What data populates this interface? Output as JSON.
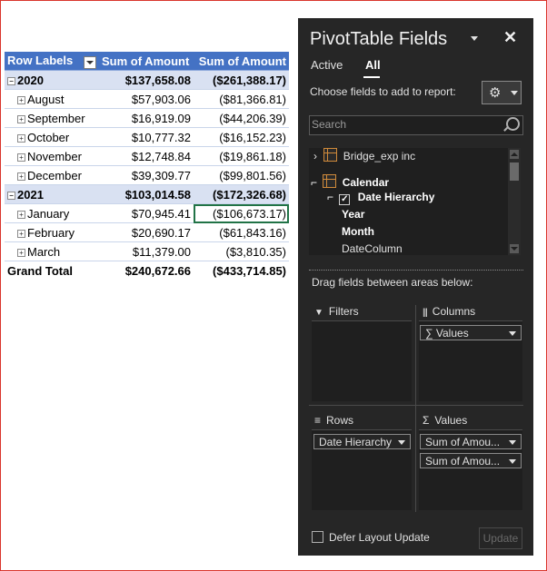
{
  "pivot": {
    "headers": [
      "Row Labels",
      "Sum of Amount",
      "Sum of Amount"
    ],
    "rows": [
      {
        "label": "2020",
        "a": "$137,658.08",
        "b": "($261,388.17)",
        "level": "year",
        "toggle": "⊟"
      },
      {
        "label": "August",
        "a": "$57,903.06",
        "b": "($81,366.81)",
        "level": "month",
        "toggle": "⊞"
      },
      {
        "label": "September",
        "a": "$16,919.09",
        "b": "($44,206.39)",
        "level": "month",
        "toggle": "⊞"
      },
      {
        "label": "October",
        "a": "$10,777.32",
        "b": "($16,152.23)",
        "level": "month",
        "toggle": "⊞"
      },
      {
        "label": "November",
        "a": "$12,748.84",
        "b": "($19,861.18)",
        "level": "month",
        "toggle": "⊞"
      },
      {
        "label": "December",
        "a": "$39,309.77",
        "b": "($99,801.56)",
        "level": "month",
        "toggle": "⊞"
      },
      {
        "label": "2021",
        "a": "$103,014.58",
        "b": "($172,326.68)",
        "level": "year",
        "toggle": "⊟"
      },
      {
        "label": "January",
        "a": "$70,945.41",
        "b": "($106,673.17)",
        "level": "month",
        "toggle": "⊞"
      },
      {
        "label": "February",
        "a": "$20,690.17",
        "b": "($61,843.16)",
        "level": "month",
        "toggle": "⊞"
      },
      {
        "label": "March",
        "a": "$11,379.00",
        "b": "($3,810.35)",
        "level": "month",
        "toggle": "⊞"
      }
    ],
    "grand_total": {
      "label": "Grand Total",
      "a": "$240,672.66",
      "b": "($433,714.85)"
    }
  },
  "pane": {
    "title": "PivotTable Fields",
    "close": "✕",
    "tabs": {
      "active": "Active",
      "all": "All"
    },
    "choose_text": "Choose fields to add to report:",
    "gear": "⚙",
    "search_placeholder": "Search",
    "fields": {
      "bridge": "Bridge_exp inc",
      "calendar": "Calendar",
      "date_hierarchy": "Date Hierarchy",
      "year": "Year",
      "month": "Month",
      "date_column": "DateColumn",
      "expand_arrow": "›",
      "collapse_arrow": "⌐",
      "check": "✓"
    },
    "drag_text": "Drag fields between areas below:",
    "areas": {
      "filters": "Filters",
      "columns": "Columns",
      "rows": "Rows",
      "values": "Values",
      "filters_icon": "▼",
      "columns_icon": "|||",
      "rows_icon": "≡",
      "values_icon": "Σ"
    },
    "chips": {
      "columns_values": "∑ Values",
      "rows_date_hierarchy": "Date Hierarchy",
      "values_1": "Sum of Amou...",
      "values_2": "Sum of Amou..."
    },
    "defer_label": "Defer Layout Update",
    "update_label": "Update"
  },
  "colors": {
    "header_blue": "#4472c4",
    "year_band": "#d9e1f2",
    "pane_bg": "#262626",
    "selection": "#217346"
  }
}
